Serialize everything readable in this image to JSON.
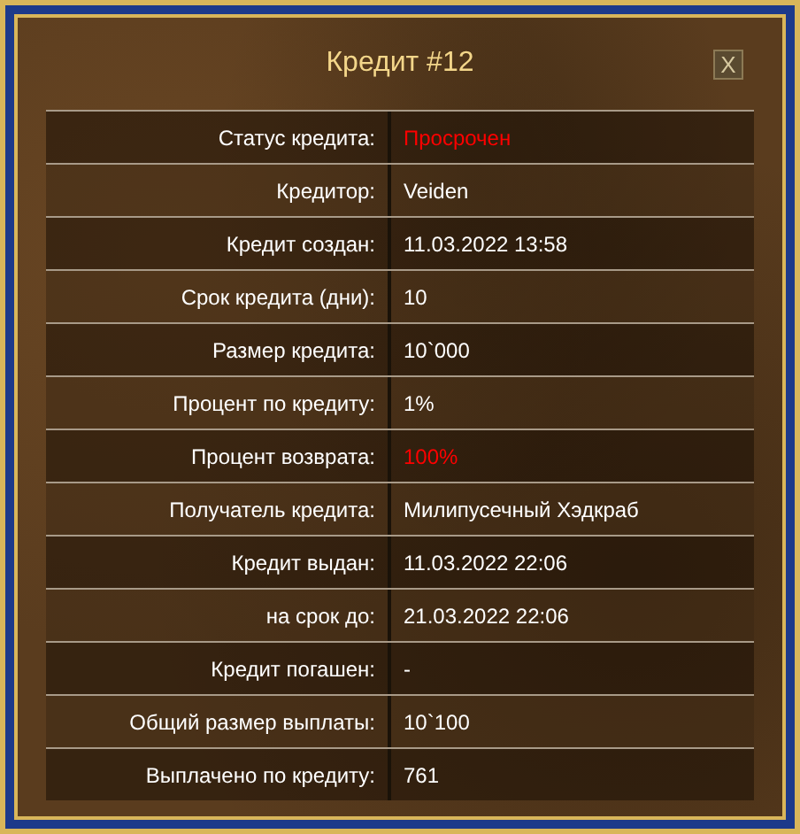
{
  "window": {
    "title": "Кредит #12",
    "close": "X"
  },
  "rows": [
    {
      "label": "Статус кредита:",
      "value": "Просрочен",
      "highlighted": true
    },
    {
      "label": "Кредитор:",
      "value": "Veiden",
      "highlighted": false
    },
    {
      "label": "Кредит создан:",
      "value": "11.03.2022 13:58",
      "highlighted": false
    },
    {
      "label": "Срок кредита (дни):",
      "value": "10",
      "highlighted": false
    },
    {
      "label": "Размер кредита:",
      "value": "10`000",
      "highlighted": false
    },
    {
      "label": "Процент по кредиту:",
      "value": "1%",
      "highlighted": false
    },
    {
      "label": "Процент возврата:",
      "value": "100%",
      "highlighted": true
    },
    {
      "label": "Получатель кредита:",
      "value": "Милипусечный Хэдкраб",
      "highlighted": false
    },
    {
      "label": "Кредит выдан:",
      "value": "11.03.2022 22:06",
      "highlighted": false
    },
    {
      "label": "на срок до:",
      "value": "21.03.2022 22:06",
      "highlighted": false
    },
    {
      "label": "Кредит погашен:",
      "value": "-",
      "highlighted": false
    },
    {
      "label": "Общий размер выплаты:",
      "value": "10`100",
      "highlighted": false
    },
    {
      "label": "Выплачено по кредиту:",
      "value": "761",
      "highlighted": false
    }
  ]
}
